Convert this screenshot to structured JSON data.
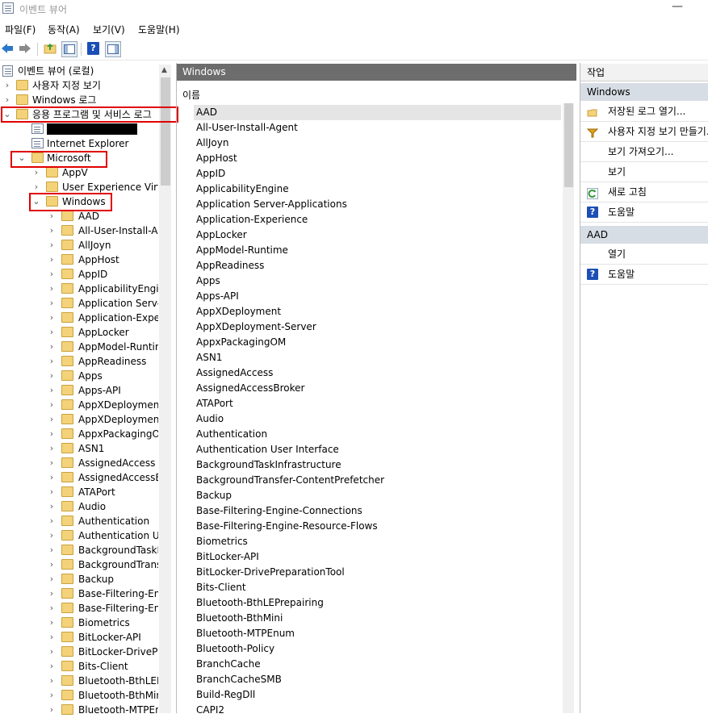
{
  "window": {
    "title": "이벤트 뷰어",
    "minimize_glyph": "—"
  },
  "menubar": {
    "items": [
      "파일(F)",
      "동작(A)",
      "보기(V)",
      "도움말(H)"
    ]
  },
  "toolbar": {
    "buttons": [
      "back-icon",
      "forward-icon",
      "folder-up-icon",
      "show-hide-tree-icon",
      "help-icon",
      "show-hide-action-icon"
    ]
  },
  "tree": {
    "root": "이벤트 뷰어 (로컬)",
    "items": [
      {
        "label": "사용자 지정 보기"
      },
      {
        "label": "Windows 로그"
      },
      {
        "label": "응용 프로그램 및 서비스 로그"
      },
      {
        "label": ""
      },
      {
        "label": "Internet Explorer"
      },
      {
        "label": "Microsoft"
      },
      {
        "label": "AppV"
      },
      {
        "label": "User Experience Virtualization"
      },
      {
        "label": "Windows"
      }
    ],
    "children": [
      "AAD",
      "All-User-Install-Agent",
      "AllJoyn",
      "AppHost",
      "AppID",
      "ApplicabilityEngine",
      "Application Server-Applications",
      "Application-Experience",
      "AppLocker",
      "AppModel-Runtime",
      "AppReadiness",
      "Apps",
      "Apps-API",
      "AppXDeployment",
      "AppXDeployment-Server",
      "AppxPackagingOM",
      "ASN1",
      "AssignedAccess",
      "AssignedAccessBroker",
      "ATAPort",
      "Audio",
      "Authentication",
      "Authentication User Interface",
      "BackgroundTaskInfrastructure",
      "BackgroundTransfer-ContentPrefetcher",
      "Backup",
      "Base-Filtering-Engine-Connections",
      "Base-Filtering-Engine-Resource-Flows",
      "Biometrics",
      "BitLocker-API",
      "BitLocker-DrivePreparationTool",
      "Bits-Client",
      "Bluetooth-BthLEPrepairing",
      "Bluetooth-BthMini",
      "Bluetooth-MTPEnum"
    ]
  },
  "center": {
    "header": "Windows",
    "column_header": "이름",
    "selected_index": 0,
    "items": [
      "AAD",
      "All-User-Install-Agent",
      "AllJoyn",
      "AppHost",
      "AppID",
      "ApplicabilityEngine",
      "Application Server-Applications",
      "Application-Experience",
      "AppLocker",
      "AppModel-Runtime",
      "AppReadiness",
      "Apps",
      "Apps-API",
      "AppXDeployment",
      "AppXDeployment-Server",
      "AppxPackagingOM",
      "ASN1",
      "AssignedAccess",
      "AssignedAccessBroker",
      "ATAPort",
      "Audio",
      "Authentication",
      "Authentication User Interface",
      "BackgroundTaskInfrastructure",
      "BackgroundTransfer-ContentPrefetcher",
      "Backup",
      "Base-Filtering-Engine-Connections",
      "Base-Filtering-Engine-Resource-Flows",
      "Biometrics",
      "BitLocker-API",
      "BitLocker-DrivePreparationTool",
      "Bits-Client",
      "Bluetooth-BthLEPrepairing",
      "Bluetooth-BthMini",
      "Bluetooth-MTPEnum",
      "Bluetooth-Policy",
      "BranchCache",
      "BranchCacheSMB",
      "Build-RegDll",
      "CAPI2"
    ]
  },
  "actions": {
    "title": "작업",
    "section1": {
      "header": "Windows",
      "items": [
        {
          "label": "저장된 로그 열기...",
          "icon": "open-folder-icon"
        },
        {
          "label": "사용자 지정 보기 만들기...",
          "icon": "filter-icon"
        },
        {
          "label": "보기 가져오기...",
          "icon": ""
        },
        {
          "label": "보기",
          "icon": ""
        },
        {
          "label": "새로 고침",
          "icon": "refresh-icon"
        },
        {
          "label": "도움말",
          "icon": "help-icon"
        }
      ]
    },
    "section2": {
      "header": "AAD",
      "items": [
        {
          "label": "열기",
          "icon": ""
        },
        {
          "label": "도움말",
          "icon": "help-icon"
        }
      ]
    }
  },
  "colors": {
    "header_bg": "#6d6d6d",
    "action_header_bg": "#d7dde5",
    "highlight_box": "#e00000",
    "selected_row": "#e5e5e5"
  }
}
